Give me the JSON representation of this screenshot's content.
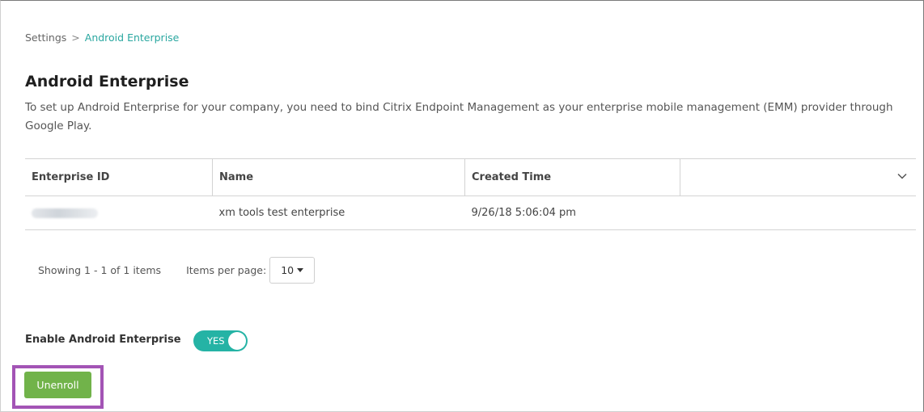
{
  "breadcrumb": {
    "parent": "Settings",
    "separator": ">",
    "current": "Android Enterprise"
  },
  "page": {
    "title": "Android Enterprise",
    "description": "To set up Android Enterprise for your company, you need to bind Citrix Endpoint Management as your enterprise mobile management (EMM) provider through Google Play."
  },
  "table": {
    "columns": [
      "Enterprise ID",
      "Name",
      "Created Time",
      ""
    ],
    "rows": [
      {
        "enterprise_id": "",
        "name": "xm tools test enterprise",
        "created_time": "9/26/18 5:06:04 pm"
      }
    ]
  },
  "pager": {
    "showing": "Showing 1 - 1 of 1 items",
    "items_per_page_label": "Items per page:",
    "items_per_page_value": "10"
  },
  "enable": {
    "label": "Enable Android Enterprise",
    "toggle_text": "YES",
    "state": "on"
  },
  "actions": {
    "unenroll_label": "Unenroll"
  },
  "colors": {
    "accent": "#25b3a5",
    "button": "#71b34a",
    "highlight": "#a354b5",
    "link": "#2aa7a0"
  },
  "icons": {
    "column_menu": "chevron-down-icon",
    "per_page_caret": "caret-down-icon"
  }
}
